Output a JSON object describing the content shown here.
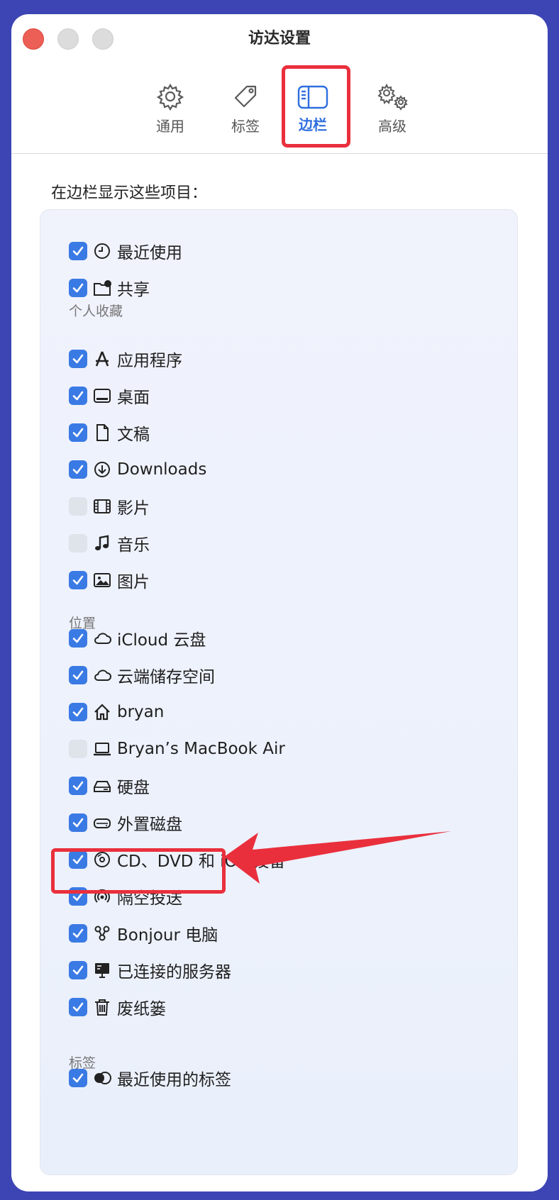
{
  "window": {
    "title": "访达设置"
  },
  "tabs": [
    {
      "label": "通用",
      "icon": "gear-icon",
      "active": false
    },
    {
      "label": "标签",
      "icon": "tag-icon",
      "active": false
    },
    {
      "label": "边栏",
      "icon": "sidebar-icon",
      "active": true
    },
    {
      "label": "高级",
      "icon": "gears-icon",
      "active": false
    }
  ],
  "intro": "在边栏显示这些项目：",
  "sections": {
    "favorites": "个人收藏",
    "locations": "位置",
    "tags": "标签"
  },
  "items": [
    {
      "label": "最近使用",
      "icon": "clock-icon",
      "checked": true
    },
    {
      "label": "共享",
      "icon": "shared-folder-icon",
      "checked": true
    },
    {
      "label": "应用程序",
      "icon": "applications-icon",
      "checked": true
    },
    {
      "label": "桌面",
      "icon": "desktop-icon",
      "checked": true
    },
    {
      "label": "文稿",
      "icon": "document-icon",
      "checked": true
    },
    {
      "label": "Downloads",
      "icon": "download-icon",
      "checked": true
    },
    {
      "label": "影片",
      "icon": "film-icon",
      "checked": false
    },
    {
      "label": "音乐",
      "icon": "music-note-icon",
      "checked": false
    },
    {
      "label": "图片",
      "icon": "photo-icon",
      "checked": true
    },
    {
      "label": "iCloud 云盘",
      "icon": "cloud-icon",
      "checked": true
    },
    {
      "label": "云端储存空间",
      "icon": "cloud-storage-icon",
      "checked": true
    },
    {
      "label": "bryan",
      "icon": "home-icon",
      "checked": true
    },
    {
      "label": "Bryan’s MacBook Air",
      "icon": "laptop-icon",
      "checked": false
    },
    {
      "label": "硬盘",
      "icon": "hard-drive-icon",
      "checked": true
    },
    {
      "label": "外置磁盘",
      "icon": "external-disk-icon",
      "checked": true
    },
    {
      "label": "CD、DVD 和 iOS 设备",
      "icon": "disc-icon",
      "checked": true
    },
    {
      "label": "隔空投送",
      "icon": "airdrop-icon",
      "checked": true
    },
    {
      "label": "Bonjour 电脑",
      "icon": "bonjour-icon",
      "checked": true
    },
    {
      "label": "已连接的服务器",
      "icon": "server-icon",
      "checked": true
    },
    {
      "label": "废纸篓",
      "icon": "trash-icon",
      "checked": true
    },
    {
      "label": "最近使用的标签",
      "icon": "tags-icon",
      "checked": true
    }
  ],
  "colors": {
    "accent": "#3a7ae4",
    "highlight": "#ea2f3c",
    "background": "#3d45b5"
  }
}
